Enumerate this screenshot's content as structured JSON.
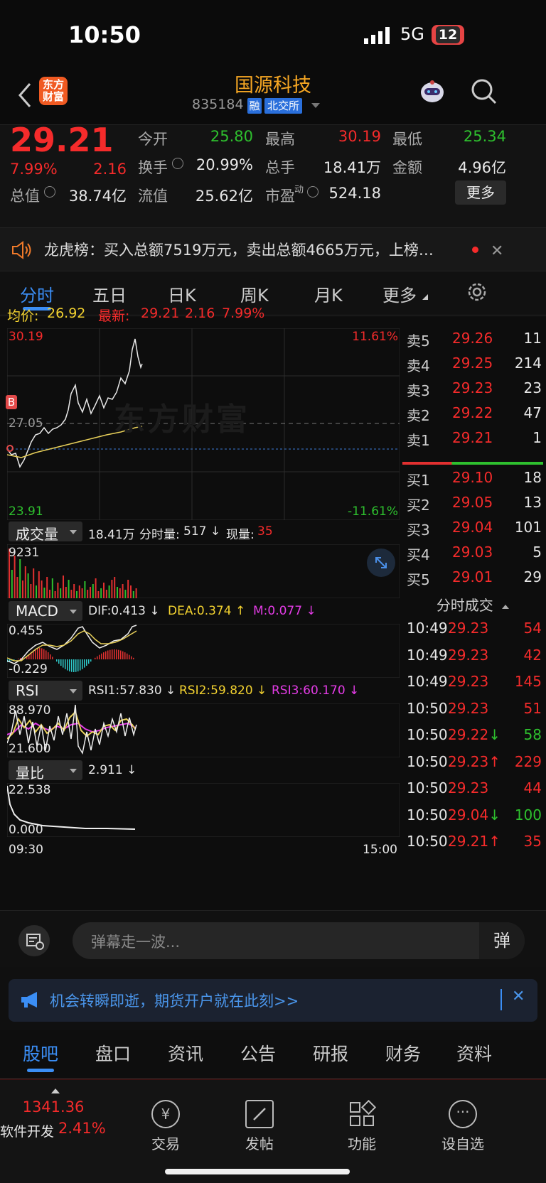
{
  "status_bar": {
    "time": "10:50",
    "network": "5G",
    "battery": "12"
  },
  "header": {
    "stock_name": "国源科技",
    "stock_code": "835184",
    "badge_margin": "融",
    "badge_exchange": "北交所",
    "app_logo_text": "东方财富"
  },
  "quote": {
    "price": "29.21",
    "change_pct": "7.99%",
    "change": "2.16",
    "items": [
      {
        "label": "今开",
        "value": "25.80",
        "color": "green"
      },
      {
        "label": "最高",
        "value": "30.19",
        "color": "red"
      },
      {
        "label": "最低",
        "value": "25.34",
        "color": "green"
      },
      {
        "label": "换手",
        "value": "20.99%",
        "color": "white"
      },
      {
        "label": "总手",
        "value": "18.41万",
        "color": "white"
      },
      {
        "label": "金额",
        "value": "4.96亿",
        "color": "white"
      },
      {
        "label": "总值",
        "value": "38.74亿",
        "color": "white"
      },
      {
        "label": "流值",
        "value": "25.62亿",
        "color": "white"
      },
      {
        "label": "市盈",
        "value": "524.18",
        "color": "white"
      }
    ],
    "pe_superscript": "动",
    "more_button": "更多"
  },
  "notice": {
    "text": "龙虎榜：买入总额7519万元，卖出总额4665万元，上榜…"
  },
  "chart_tabs": [
    "分时",
    "五日",
    "日K",
    "周K",
    "月K",
    "更多"
  ],
  "intraday": {
    "avg_label": "均价:",
    "avg_value": "26.92",
    "latest_label": "最新:",
    "latest_value": "29.21",
    "latest_change": "2.16",
    "latest_pct": "7.99%",
    "y_high": "30.19",
    "y_high_pct": "11.61%",
    "y_mid": "27.05",
    "y_low": "23.91",
    "y_low_pct": "-11.61%",
    "marker_b": "B",
    "watermark": "东方财富",
    "time_start": "09:30",
    "time_end": "15:00"
  },
  "indicators": {
    "volume": {
      "label": "成交量",
      "total": "18.41万",
      "minute_label": "分时量:",
      "minute_val": "517 ↓",
      "now_label": "现量:",
      "now_val": "35",
      "axis_max": "9231"
    },
    "macd": {
      "label": "MACD",
      "dif": "DIF:0.413 ↓",
      "dea": "DEA:0.374 ↑",
      "m": "M:0.077 ↓",
      "axis_max": "0.455",
      "axis_min": "-0.229"
    },
    "rsi": {
      "label": "RSI",
      "rsi1": "RSI1:57.830 ↓",
      "rsi2": "RSI2:59.820 ↓",
      "rsi3": "RSI3:60.170 ↓",
      "axis_max": "88.970",
      "axis_min": "21.600"
    },
    "ratio": {
      "label": "量比",
      "value": "2.911 ↓",
      "axis_max": "22.538",
      "axis_min": "0.000"
    }
  },
  "order_book": {
    "sells": [
      {
        "label": "卖5",
        "price": "29.26",
        "vol": "11"
      },
      {
        "label": "卖4",
        "price": "29.25",
        "vol": "214"
      },
      {
        "label": "卖3",
        "price": "29.23",
        "vol": "23"
      },
      {
        "label": "卖2",
        "price": "29.22",
        "vol": "47"
      },
      {
        "label": "卖1",
        "price": "29.21",
        "vol": "1"
      }
    ],
    "buys": [
      {
        "label": "买1",
        "price": "29.10",
        "vol": "18"
      },
      {
        "label": "买2",
        "price": "29.05",
        "vol": "13"
      },
      {
        "label": "买3",
        "price": "29.04",
        "vol": "101"
      },
      {
        "label": "买4",
        "price": "29.03",
        "vol": "5"
      },
      {
        "label": "买5",
        "price": "29.01",
        "vol": "29"
      }
    ]
  },
  "ticks": {
    "title": "分时成交",
    "rows": [
      {
        "time": "10:49",
        "price": "29.23",
        "vol": "54",
        "vol_color": "red"
      },
      {
        "time": "10:49",
        "price": "29.23",
        "vol": "42",
        "vol_color": "red"
      },
      {
        "time": "10:49",
        "price": "29.23",
        "vol": "145",
        "vol_color": "red"
      },
      {
        "time": "10:50",
        "price": "29.23",
        "vol": "51",
        "vol_color": "red"
      },
      {
        "time": "10:50",
        "price": "29.22↓",
        "vol": "58",
        "vol_color": "green"
      },
      {
        "time": "10:50",
        "price": "29.23↑",
        "vol": "229",
        "vol_color": "red"
      },
      {
        "time": "10:50",
        "price": "29.23",
        "vol": "44",
        "vol_color": "red"
      },
      {
        "time": "10:50",
        "price": "29.04↓",
        "vol": "100",
        "vol_color": "green"
      },
      {
        "time": "10:50",
        "price": "29.21↑",
        "vol": "35",
        "vol_color": "red"
      }
    ]
  },
  "danmaku": {
    "placeholder": "弹幕走一波...",
    "button": "弹"
  },
  "ad": {
    "text": "机会转瞬即逝，期货开户就在此刻>>"
  },
  "bottom_tabs": [
    "股吧",
    "盘口",
    "资讯",
    "公告",
    "研报",
    "财务",
    "资料"
  ],
  "nav": {
    "index_value": "1341.36",
    "index_name": "软件开发",
    "index_pct": "2.41%",
    "items": [
      "交易",
      "发帖",
      "功能",
      "设自选"
    ]
  }
}
